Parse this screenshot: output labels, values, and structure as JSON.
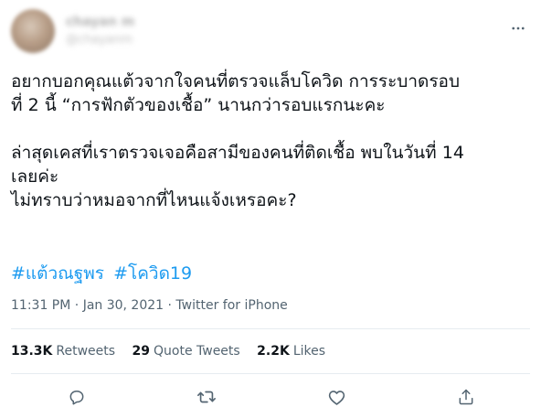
{
  "author": {
    "display_name": "chayan m",
    "handle": "@chayanm"
  },
  "tweet": {
    "paragraphs": [
      [
        "อยากบอกคุณแต้วจากใจคนที่ตรวจแล็บโควิด การระบาดรอบ",
        "ที่ 2 นี้ “การฟักตัวของเชื้อ” นานกว่ารอบแรกนะคะ"
      ],
      [
        "ล่าสุดเคสที่เราตรวจเจอคือสามีของคนที่ติดเชื้อ พบในวันที่ 14",
        "เลยค่ะ",
        "ไม่ทราบว่าหมอจากที่ไหนแจ้งเหรอคะ?"
      ]
    ],
    "hashtags": [
      "#แต้วณฐพร",
      "#โควิด19"
    ],
    "time": "11:31 PM",
    "separator": "·",
    "date": "Jan 30, 2021",
    "source": "Twitter for iPhone"
  },
  "stats": {
    "retweets_count": "13.3K",
    "retweets_label": "Retweets",
    "quotes_count": "29",
    "quotes_label": "Quote Tweets",
    "likes_count": "2.2K",
    "likes_label": "Likes"
  },
  "icons": {
    "more": "more-icon",
    "reply": "reply-icon",
    "retweet": "retweet-icon",
    "like": "like-icon",
    "share": "share-icon"
  },
  "colors": {
    "text": "#0f1419",
    "secondary": "#536471",
    "link": "#1d9bf0",
    "divider": "#e6ecf0"
  }
}
